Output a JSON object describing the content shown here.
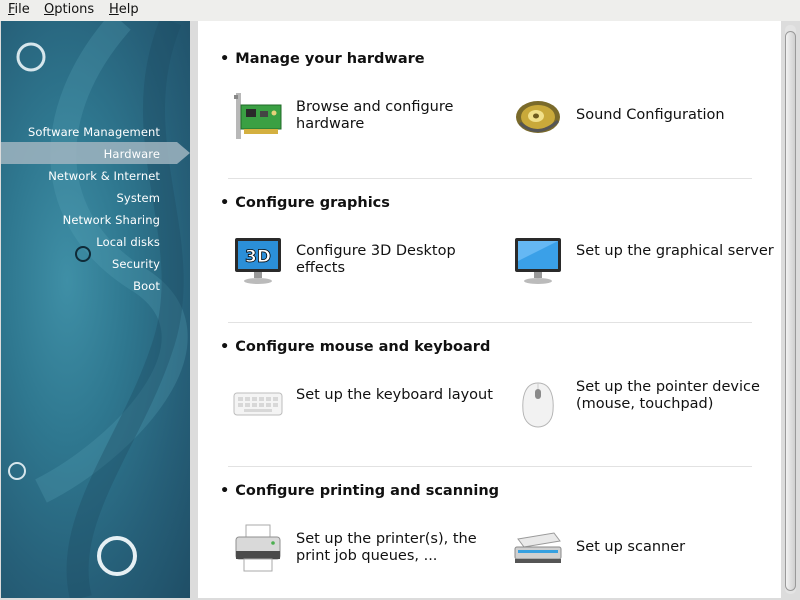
{
  "menubar": {
    "file": {
      "first": "F",
      "rest": "ile"
    },
    "options": {
      "first": "O",
      "rest": "ptions"
    },
    "help": {
      "first": "H",
      "rest": "elp"
    }
  },
  "sidebar": {
    "items": [
      {
        "label": "Software Management"
      },
      {
        "label": "Hardware",
        "active": true
      },
      {
        "label": "Network & Internet"
      },
      {
        "label": "System"
      },
      {
        "label": "Network Sharing"
      },
      {
        "label": "Local disks"
      },
      {
        "label": "Security"
      },
      {
        "label": "Boot"
      }
    ]
  },
  "sections": [
    {
      "title": "Manage your hardware",
      "items": [
        {
          "label": "Browse and configure hardware",
          "icon": "pci-card-icon"
        },
        {
          "label": "Sound Configuration",
          "icon": "speaker-icon"
        }
      ]
    },
    {
      "title": "Configure graphics",
      "items": [
        {
          "label": "Configure 3D Desktop effects",
          "icon": "3d-monitor-icon",
          "icon_text": "3D"
        },
        {
          "label": "Set up the graphical server",
          "icon": "monitor-icon"
        }
      ]
    },
    {
      "title": "Configure mouse and keyboard",
      "items": [
        {
          "label": "Set up the keyboard layout",
          "icon": "keyboard-icon"
        },
        {
          "label": "Set up the pointer device (mouse, touchpad)",
          "icon": "mouse-icon"
        }
      ]
    },
    {
      "title": "Configure printing and scanning",
      "items": [
        {
          "label": "Set up the printer(s), the print job queues, ...",
          "icon": "printer-icon"
        },
        {
          "label": "Set up scanner",
          "icon": "scanner-icon"
        }
      ]
    }
  ],
  "colors": {
    "sidebar_bg": "#2f7890",
    "active_item": "#9fb4bf",
    "content_bg": "#ffffff"
  }
}
